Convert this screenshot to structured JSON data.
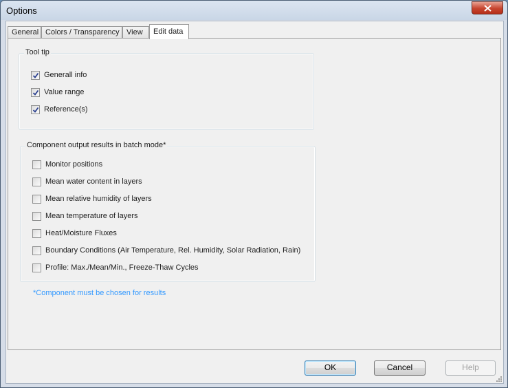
{
  "window": {
    "title": "Options"
  },
  "tabs": [
    {
      "label": "General"
    },
    {
      "label": "Colors / Transparency"
    },
    {
      "label": "View"
    },
    {
      "label": "Edit data",
      "active": true
    }
  ],
  "tooltip_group": {
    "label": "Tool tip",
    "items": [
      {
        "label": "Generall info",
        "checked": true
      },
      {
        "label": "Value range",
        "checked": true
      },
      {
        "label": "Reference(s)",
        "checked": true
      }
    ]
  },
  "output_group": {
    "label": "Component output results in batch mode*",
    "items": [
      {
        "label": "Monitor positions",
        "checked": false
      },
      {
        "label": "Mean water content in layers",
        "checked": false
      },
      {
        "label": "Mean relative humidity of layers",
        "checked": false
      },
      {
        "label": "Mean temperature of layers",
        "checked": false
      },
      {
        "label": "Heat/Moisture Fluxes",
        "checked": false
      },
      {
        "label": "Boundary Conditions (Air Temperature, Rel. Humidity, Solar Radiation, Rain)",
        "checked": false
      },
      {
        "label": "Profile: Max./Mean/Min., Freeze-Thaw Cycles",
        "checked": false
      }
    ]
  },
  "note": "*Component must be chosen for results",
  "buttons": {
    "ok": "OK",
    "cancel": "Cancel",
    "help": "Help"
  },
  "colors": {
    "note": "#3399ff",
    "close_button": "#c7452f"
  }
}
